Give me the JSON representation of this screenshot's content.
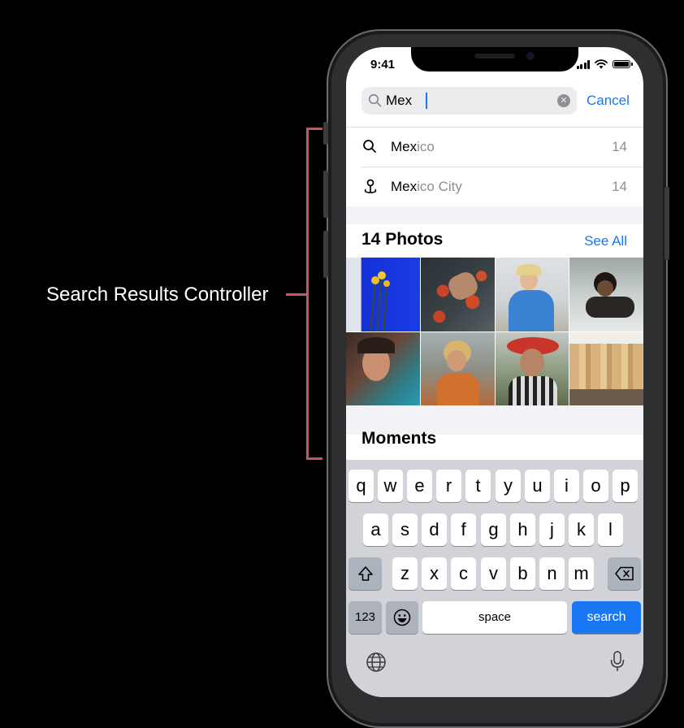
{
  "annotation": {
    "label": "Search Results Controller",
    "color": "#c9555f"
  },
  "status_bar": {
    "time": "9:41"
  },
  "search": {
    "value": "Mex",
    "cancel_label": "Cancel"
  },
  "suggestions": [
    {
      "icon": "magnifier-icon",
      "typed": "Mex",
      "rest": "ico",
      "count": "14"
    },
    {
      "icon": "location-pin-icon",
      "typed": "Mex",
      "rest": "ico City",
      "count": "14"
    }
  ],
  "photos_section": {
    "title": "14 Photos",
    "see_all_label": "See All"
  },
  "moments_section": {
    "title": "Moments"
  },
  "keyboard": {
    "row1": [
      "q",
      "w",
      "e",
      "r",
      "t",
      "y",
      "u",
      "i",
      "o",
      "p"
    ],
    "row2": [
      "a",
      "s",
      "d",
      "f",
      "g",
      "h",
      "j",
      "k",
      "l"
    ],
    "row3": [
      "z",
      "x",
      "c",
      "v",
      "b",
      "n",
      "m"
    ],
    "numbers_label": "123",
    "space_label": "space",
    "search_label": "search"
  },
  "colors": {
    "accent": "#1977f3",
    "keyboard_bg": "#d1d3d9"
  }
}
